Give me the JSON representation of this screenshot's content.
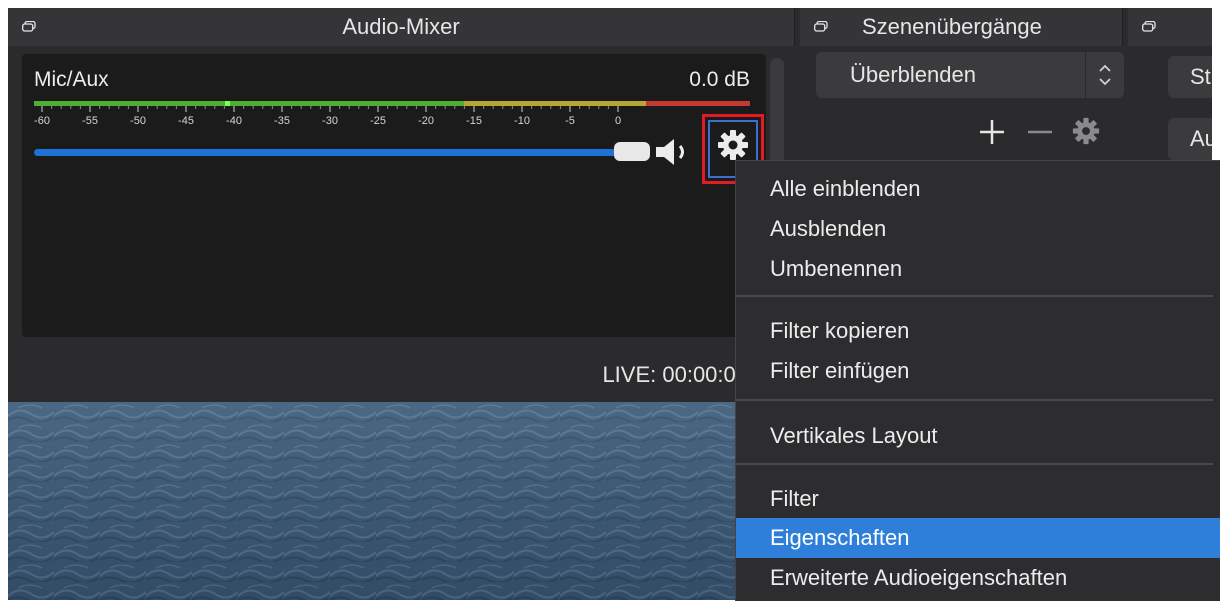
{
  "docks": {
    "audio_mixer_title": "Audio-Mixer",
    "scene_transitions_title": "Szenenübergänge"
  },
  "mixer": {
    "track_name": "Mic/Aux",
    "level_db": "0.0 dB",
    "meter_ticks": [
      "-60",
      "-55",
      "-50",
      "-45",
      "-40",
      "-35",
      "-30",
      "-25",
      "-20",
      "-15",
      "-10",
      "-5",
      "0"
    ],
    "volume_fraction": 0.92,
    "status_text": "LIVE: 00:00:00"
  },
  "transitions": {
    "selected": "Überblenden",
    "add_icon": "plus-icon",
    "remove_icon": "minus-icon",
    "settings_icon": "gear-icon"
  },
  "controls_partial": {
    "button1": "St",
    "button2": "Au"
  },
  "context_menu": {
    "groups": [
      [
        "Alle einblenden",
        "Ausblenden",
        "Umbenennen"
      ],
      [
        "Filter kopieren",
        "Filter einfügen"
      ],
      [
        "Vertikales Layout"
      ],
      [
        "Filter",
        "Eigenschaften",
        "Erweiterte Audioeigenschaften"
      ]
    ],
    "active_item": "Eigenschaften"
  },
  "colors": {
    "accent_blue": "#2e7fd9",
    "highlight_red": "#e31b23",
    "slider_blue": "#1e72d6",
    "meter_green": "#4caf32",
    "meter_yellow": "#b9a531",
    "meter_red": "#c43a30"
  }
}
